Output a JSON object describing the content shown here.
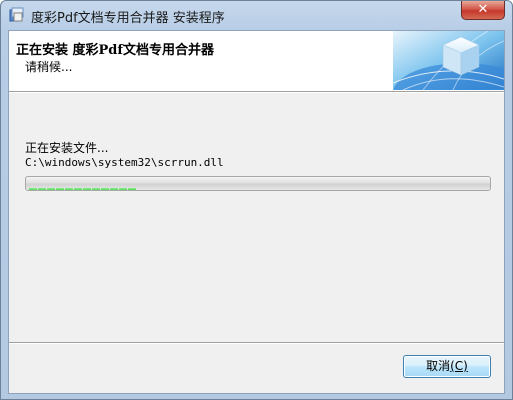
{
  "window": {
    "title": "度彩Pdf文档专用合并器 安装程序",
    "close_label": "✕"
  },
  "header": {
    "title": "正在安装 度彩Pdf文档专用合并器",
    "subtitle": "请稍候..."
  },
  "status": {
    "label": "正在安装文件...",
    "path": "C:\\windows\\system32\\scrrun.dll"
  },
  "progress": {
    "percent": 24,
    "color": "#1fc81f"
  },
  "buttons": {
    "cancel_label": "取消",
    "cancel_accel": "(C)"
  },
  "icons": {
    "app": "installer-icon",
    "header": "cube-globe-graphic"
  }
}
